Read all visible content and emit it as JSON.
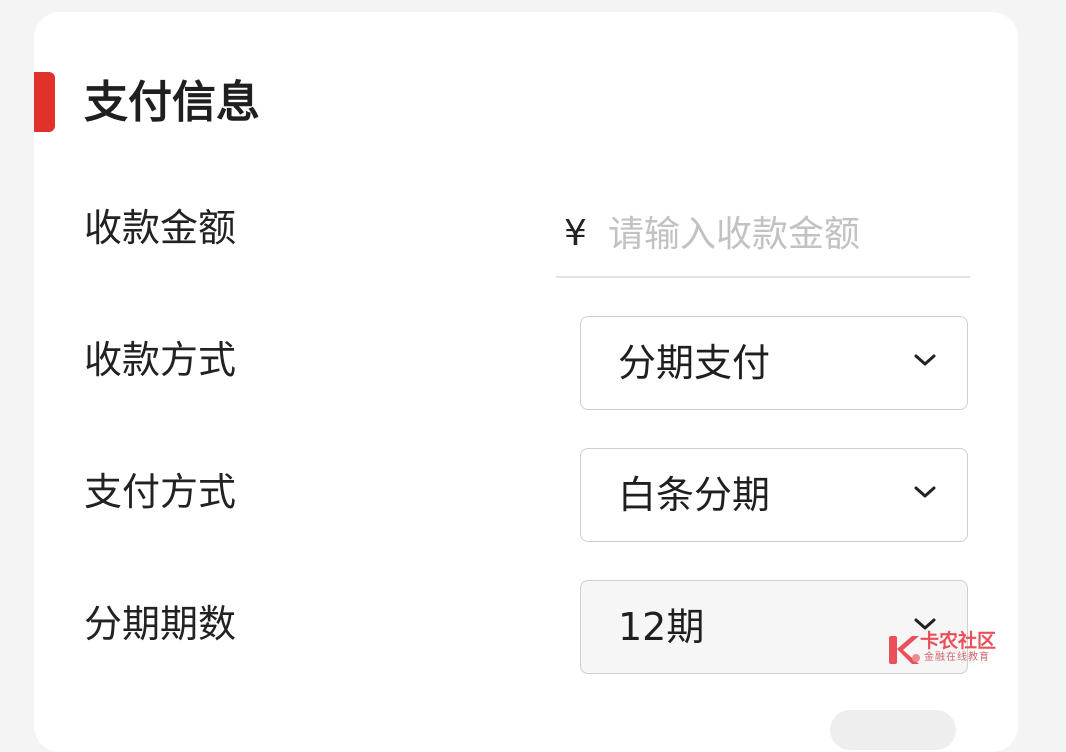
{
  "section": {
    "title": "支付信息",
    "accent_color": "#e0322b"
  },
  "amount": {
    "label": "收款金额",
    "currency_symbol": "¥",
    "value": "",
    "placeholder": "请输入收款金额"
  },
  "collection_method": {
    "label": "收款方式",
    "selected": "分期支付",
    "icon": "chevron-down-icon"
  },
  "payment_method": {
    "label": "支付方式",
    "selected": "白条分期",
    "icon": "chevron-down-icon"
  },
  "installments": {
    "label": "分期期数",
    "selected": "12期",
    "icon": "chevron-down-icon"
  },
  "watermark": {
    "title": "卡农社区",
    "subtitle": "金融在线教育",
    "color": "#e9505a"
  }
}
